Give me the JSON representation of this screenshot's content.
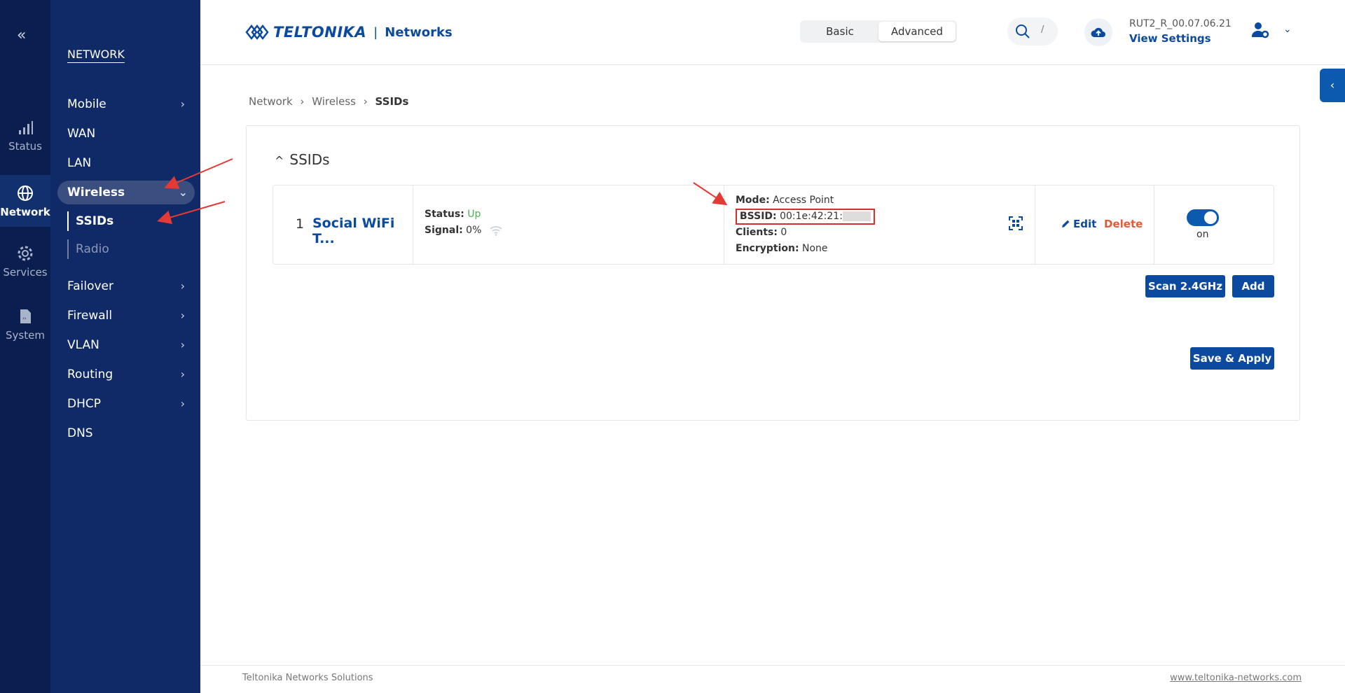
{
  "rail": {
    "collapse_icon": "«",
    "items": [
      {
        "label": "Status",
        "icon": "bar-chart-icon"
      },
      {
        "label": "Network",
        "icon": "globe-icon"
      },
      {
        "label": "Services",
        "icon": "gear-icon"
      },
      {
        "label": "System",
        "icon": "document-icon"
      }
    ]
  },
  "menu": {
    "header": "NETWORK",
    "items": [
      "Mobile",
      "WAN",
      "LAN",
      "Wireless",
      "Failover",
      "Firewall",
      "VLAN",
      "Routing",
      "DHCP",
      "DNS"
    ],
    "submenu": [
      "SSIDs",
      "Radio"
    ]
  },
  "header": {
    "brand": "TELTONIKA",
    "separator": "|",
    "networks": "Networks",
    "modes": [
      "Basic",
      "Advanced"
    ],
    "search_hint": "/",
    "firmware": "RUT2_R_00.07.06.21",
    "view_settings": "View Settings"
  },
  "breadcrumb": {
    "items": [
      "Network",
      "Wireless",
      "SSIDs"
    ],
    "separator": "›"
  },
  "section": {
    "caret": "^",
    "title": "SSIDs"
  },
  "ssid": {
    "index": "1",
    "name": "Social WiFi T...",
    "status_label": "Status:",
    "status_value": "Up",
    "signal_label": "Signal:",
    "signal_value": "0%",
    "mode_label": "Mode:",
    "mode_value": "Access Point",
    "bssid_label": "BSSID:",
    "bssid_value": "00:1e:42:21:",
    "clients_label": "Clients:",
    "clients_value": "0",
    "encryption_label": "Encryption:",
    "encryption_value": "None",
    "edit": "Edit",
    "delete": "Delete",
    "toggle_label": "on"
  },
  "buttons": {
    "scan": "Scan 2.4GHz",
    "add": "Add",
    "save": "Save & Apply"
  },
  "footer": {
    "left": "Teltonika Networks Solutions",
    "right": "www.teltonika-networks.com"
  },
  "colors": {
    "sidebar": "#0f2a66",
    "rail": "#0a1f4f",
    "primary": "#0b4a9e",
    "annotation": "#d32f2f",
    "status_up": "#4caf50",
    "delete": "#e05a3a"
  }
}
